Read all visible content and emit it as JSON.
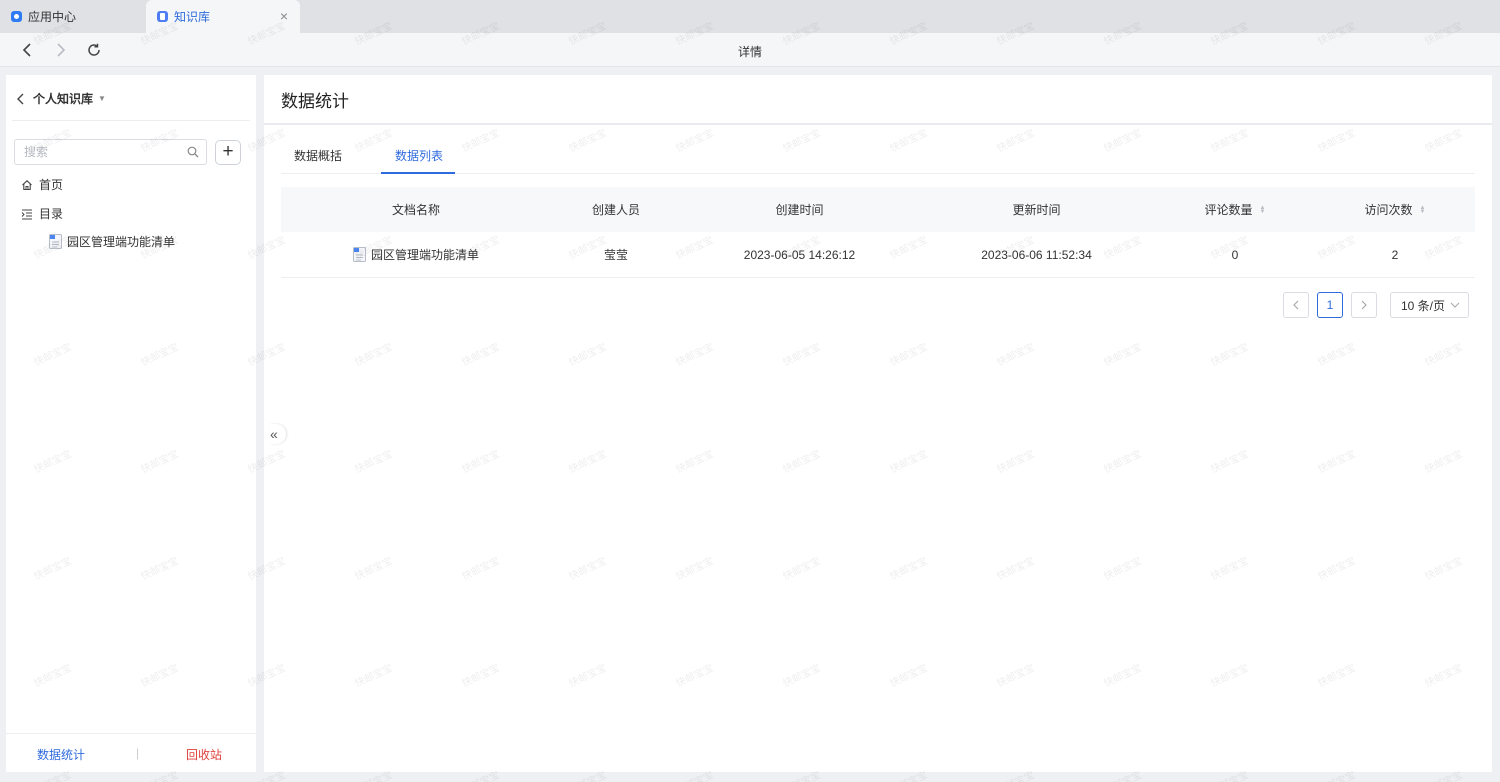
{
  "browser": {
    "tabs": [
      {
        "label": "应用中心",
        "icon": "app-icon"
      },
      {
        "label": "知识库",
        "icon": "knowledge-icon",
        "active": true
      }
    ],
    "close_glyph": "×",
    "page_title": "详情"
  },
  "sidebar": {
    "kb_name": "个人知识库",
    "search_placeholder": "搜索",
    "add_glyph": "+",
    "items": [
      {
        "label": "首页",
        "icon": "home-icon"
      },
      {
        "label": "目录",
        "icon": "list-icon"
      }
    ],
    "doc_tree": [
      {
        "label": "园区管理端功能清单",
        "icon": "document-icon"
      }
    ],
    "footer": {
      "stats_label": "数据统计",
      "separator": "|",
      "trash_label": "回收站"
    }
  },
  "main": {
    "title": "数据统计",
    "tabs": [
      {
        "label": "数据概括"
      },
      {
        "label": "数据列表",
        "active": true
      }
    ],
    "table": {
      "columns": [
        "文档名称",
        "创建人员",
        "创建时间",
        "更新时间",
        "评论数量",
        "访问次数"
      ],
      "rows": [
        {
          "name": "园区管理端功能清单",
          "creator": "莹莹",
          "created": "2023-06-05 14:26:12",
          "updated": "2023-06-06 11:52:34",
          "comments": "0",
          "visits": "2"
        }
      ]
    },
    "pagination": {
      "current_page": "1",
      "page_size": "10 条/页"
    },
    "collapse_glyph": "«"
  },
  "watermark": {
    "text": "快邮宝宝"
  },
  "colors": {
    "accent": "#2f6bdc",
    "danger": "#e0403c",
    "background": "#eef0f3",
    "table_header": "#f7f8fa"
  }
}
